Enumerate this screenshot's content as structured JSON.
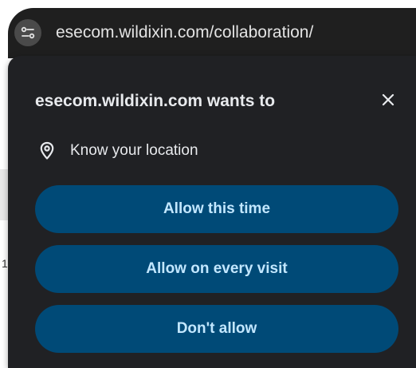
{
  "omnibox": {
    "url": "esecom.wildixin.com/collaboration/",
    "site_info_icon": "tune-icon"
  },
  "background": {
    "partial_char": "1"
  },
  "permission_prompt": {
    "title": "esecom.wildixin.com wants to",
    "close_icon": "close-icon",
    "permission": {
      "icon": "location-pin-icon",
      "label": "Know your location"
    },
    "buttons": {
      "allow_once": "Allow this time",
      "allow_always": "Allow on every visit",
      "deny": "Don't allow"
    }
  },
  "colors": {
    "bubble_background": "#202124",
    "button_background": "#004a77",
    "button_text": "#c2e7ff",
    "text": "#e8eaed"
  }
}
